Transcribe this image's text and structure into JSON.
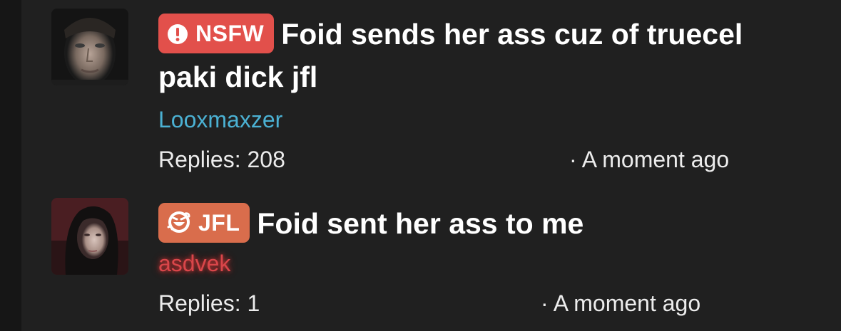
{
  "threads": [
    {
      "prefix": {
        "label": "NSFW",
        "icon": "exclamation-circle-icon",
        "color": "#e2504b"
      },
      "title": "Foid sends her ass cuz of truecel paki dick jfl",
      "author": "Looxmaxzer",
      "author_color": "#4bb1d3",
      "replies": "Replies: 208",
      "time": "· A moment ago"
    },
    {
      "prefix": {
        "label": "JFL",
        "icon": "laughing-face-icon",
        "color": "#d96d4c"
      },
      "title": "Foid sent her ass to me",
      "author": "asdvek",
      "author_color": "#d9464a",
      "replies": "Replies: 1",
      "time": "· A moment ago"
    }
  ]
}
